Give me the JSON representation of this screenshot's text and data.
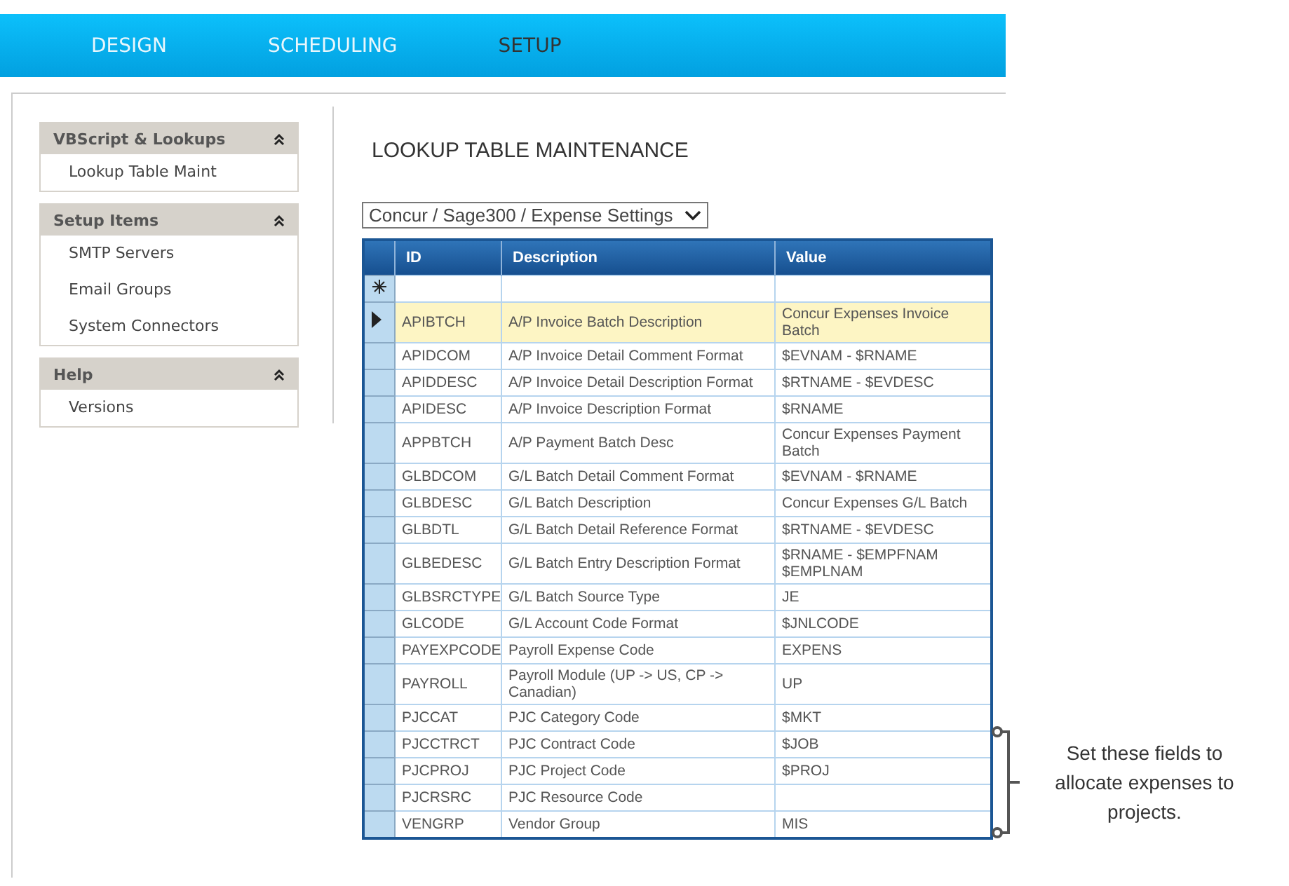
{
  "nav": {
    "tabs": [
      {
        "label": "DESIGN",
        "selected": false
      },
      {
        "label": "SCHEDULING",
        "selected": false
      },
      {
        "label": "SETUP",
        "selected": true
      }
    ]
  },
  "sidebar": {
    "groups": [
      {
        "title": "VBScript & Lookups",
        "items": [
          "Lookup Table Maint"
        ]
      },
      {
        "title": "Setup Items",
        "items": [
          "SMTP Servers",
          "Email Groups",
          "System Connectors"
        ]
      },
      {
        "title": "Help",
        "items": [
          "Versions"
        ]
      }
    ]
  },
  "page_title": "LOOKUP TABLE MAINTENANCE",
  "table_select": {
    "value": "Concur / Sage300 / Expense Settings"
  },
  "table": {
    "columns": [
      "ID",
      "Description",
      "Value"
    ],
    "rows": [
      {
        "id": "APIBTCH",
        "description": "A/P Invoice Batch Description",
        "value": "Concur Expenses Invoice Batch",
        "selected": true
      },
      {
        "id": "APIDCOM",
        "description": "A/P Invoice Detail Comment Format",
        "value": "$EVNAM - $RNAME",
        "selected": false
      },
      {
        "id": "APIDDESC",
        "description": "A/P Invoice Detail Description Format",
        "value": "$RTNAME - $EVDESC",
        "selected": false
      },
      {
        "id": "APIDESC",
        "description": "A/P Invoice Description Format",
        "value": "$RNAME",
        "selected": false
      },
      {
        "id": "APPBTCH",
        "description": "A/P Payment Batch Desc",
        "value": "Concur Expenses Payment Batch",
        "selected": false
      },
      {
        "id": "GLBDCOM",
        "description": "G/L Batch Detail Comment Format",
        "value": "$EVNAM - $RNAME",
        "selected": false
      },
      {
        "id": "GLBDESC",
        "description": "G/L Batch Description",
        "value": "Concur Expenses G/L Batch",
        "selected": false
      },
      {
        "id": "GLBDTL",
        "description": "G/L Batch Detail Reference Format",
        "value": "$RTNAME - $EVDESC",
        "selected": false
      },
      {
        "id": "GLBEDESC",
        "description": "G/L Batch Entry Description Format",
        "value": "$RNAME - $EMPFNAM $EMPLNAM",
        "selected": false
      },
      {
        "id": "GLBSRCTYPE",
        "description": "G/L Batch Source Type",
        "value": "JE",
        "selected": false
      },
      {
        "id": "GLCODE",
        "description": "G/L Account Code Format",
        "value": "$JNLCODE",
        "selected": false
      },
      {
        "id": "PAYEXPCODE",
        "description": "Payroll Expense Code",
        "value": "EXPENS",
        "selected": false
      },
      {
        "id": "PAYROLL",
        "description": "Payroll Module (UP -> US, CP -> Canadian)",
        "value": "UP",
        "selected": false
      },
      {
        "id": "PJCCAT",
        "description": "PJC Category Code",
        "value": "$MKT",
        "selected": false
      },
      {
        "id": "PJCCTRCT",
        "description": "PJC Contract Code",
        "value": "$JOB",
        "selected": false
      },
      {
        "id": "PJCPROJ",
        "description": "PJC Project Code",
        "value": "$PROJ",
        "selected": false
      },
      {
        "id": "PJCRSRC",
        "description": "PJC Resource Code",
        "selected": false
      },
      {
        "id": "VENGRP",
        "description": "Vendor Group",
        "value": "MIS",
        "selected": false
      }
    ]
  },
  "annotation": {
    "text": "Set these fields to allocate expenses to projects."
  }
}
